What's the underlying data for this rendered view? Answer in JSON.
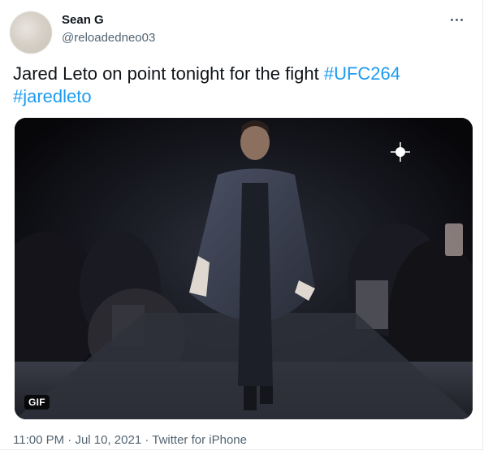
{
  "tweet": {
    "author_name": "Sean G",
    "author_handle": "@reloadedneo03",
    "text_prefix": "Jared Leto on point tonight for the fight ",
    "hashtags": [
      "#UFC264",
      "#jaredleto"
    ],
    "media_badge": "GIF",
    "time": "11:00 PM",
    "separator": "·",
    "date": "Jul 10, 2021",
    "source": "Twitter for iPhone"
  },
  "icons": {
    "more": "more-horizontal-icon"
  },
  "colors": {
    "text": "#0f1419",
    "secondary": "#536471",
    "link": "#1d9bf0"
  }
}
